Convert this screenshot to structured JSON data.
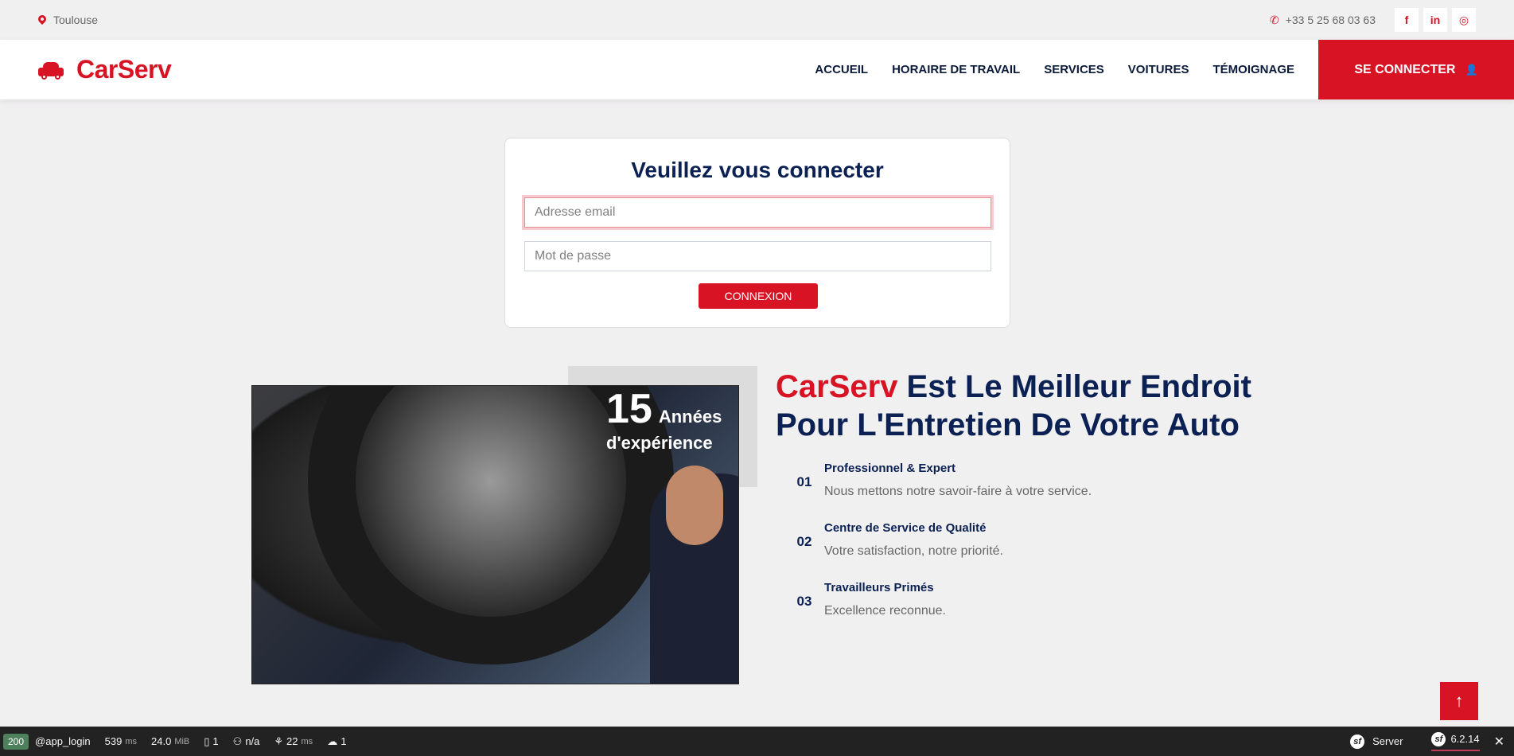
{
  "topbar": {
    "location": "Toulouse",
    "phone": "+33 5 25 68 03 63",
    "social": [
      "f",
      "in",
      "◎"
    ]
  },
  "navbar": {
    "brand": "CarServ",
    "links": [
      "ACCUEIL",
      "HORAIRE DE TRAVAIL",
      "SERVICES",
      "VOITURES",
      "TÉMOIGNAGE"
    ],
    "login_label": "SE CONNECTER"
  },
  "login": {
    "title": "Veuillez vous connecter",
    "email_placeholder": "Adresse email",
    "password_placeholder": "Mot de passe",
    "submit_label": "CONNEXION"
  },
  "about": {
    "experience_number": "15",
    "experience_label_1": "Années",
    "experience_label_2": "d'expérience",
    "title_brand": "CarServ",
    "title_rest": " Est Le Meilleur Endroit Pour L'Entretien De Votre Auto",
    "features": [
      {
        "num": "01",
        "title": "Professionnel & Expert",
        "desc": "Nous mettons notre savoir-faire à votre service."
      },
      {
        "num": "02",
        "title": "Centre de Service de Qualité",
        "desc": "Votre satisfaction, notre priorité."
      },
      {
        "num": "03",
        "title": "Travailleurs Primés",
        "desc": "Excellence reconnue."
      }
    ]
  },
  "back_to_top": "↑",
  "debug_toolbar": {
    "status": "200",
    "route": "@app_login",
    "time": "539",
    "time_unit": "ms",
    "memory": "24.0",
    "memory_unit": "MiB",
    "files": "1",
    "user": "n/a",
    "twig_time": "22",
    "twig_unit": "ms",
    "ajax": "1",
    "server_label": "Server",
    "version": "6.2.14",
    "close": "✕"
  },
  "colors": {
    "accent": "#d81324",
    "navy": "#0b2154",
    "background": "#f1f0f1"
  }
}
